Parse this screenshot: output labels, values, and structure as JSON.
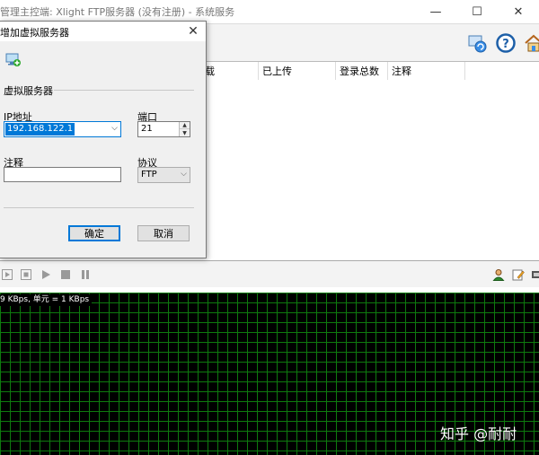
{
  "main_window": {
    "title": "管理主控端: Xlight FTP服务器 (没有注册) - 系统服务",
    "minimize_glyph": "—",
    "maximize_glyph": "☐",
    "close_glyph": "✕"
  },
  "toolbar": {
    "icons": [
      "refresh-icon",
      "help-icon",
      "home-icon"
    ]
  },
  "list": {
    "columns": [
      "载",
      "已上传",
      "登录总数",
      "注释"
    ]
  },
  "controls": {
    "icons": [
      "restart-icon",
      "stop-icon",
      "play-icon",
      "stop-square-icon",
      "pause-icon",
      "user-icon",
      "edit-icon",
      "settings-icon"
    ]
  },
  "graph": {
    "label": "9 KBps, 单元 = 1 KBps"
  },
  "dialog": {
    "title": "增加虚拟服务器",
    "close_glyph": "✕",
    "group_title": "虚拟服务器",
    "ip_label": "IP地址",
    "ip_value": "192.168.122.1",
    "port_label": "端口",
    "port_value": "21",
    "note_label": "注释",
    "note_value": "",
    "protocol_label": "协议",
    "protocol_value": "FTP",
    "ok_label": "确定",
    "cancel_label": "取消"
  },
  "watermark": {
    "text": "知乎 @耐耐"
  },
  "colors": {
    "accent": "#0078d7",
    "grid_line": "#0e7a0e",
    "graph_bg": "#000000"
  }
}
